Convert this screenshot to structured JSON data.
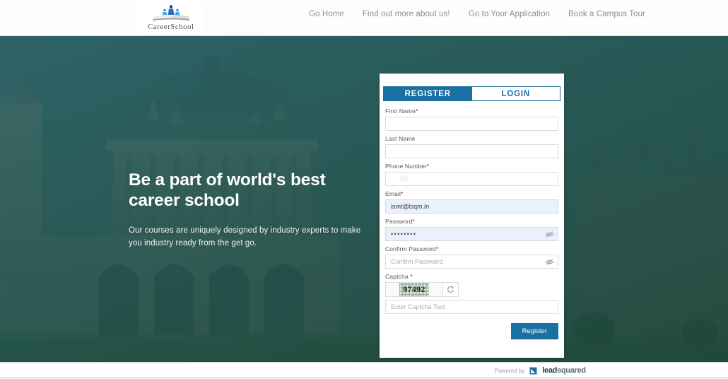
{
  "header": {
    "logo": {
      "icon": "careerschool-logo-icon",
      "text": "CareerSchool"
    },
    "nav": [
      {
        "label": "Go Home"
      },
      {
        "label": "Find out more about us!"
      },
      {
        "label": "Go to Your Application"
      },
      {
        "label": "Book a Campus Tour"
      }
    ]
  },
  "hero": {
    "title": "Be a part of world's best career school",
    "subtitle": "Our courses are uniquely designed by industry experts  to make you industry ready from the get go."
  },
  "card": {
    "tabs": [
      {
        "label": "REGISTER",
        "active": true
      },
      {
        "label": "LOGIN",
        "active": false
      }
    ],
    "fields": {
      "first_name": {
        "label": "First Name",
        "required": "*",
        "value": "",
        "placeholder": ""
      },
      "last_name": {
        "label": "Last Name",
        "required": "",
        "value": "",
        "placeholder": ""
      },
      "phone": {
        "label": "Phone Number",
        "required": "*",
        "value": "",
        "placeholder": ""
      },
      "email": {
        "label": "Email",
        "required": "*",
        "value": "ismt@lsqm.in",
        "placeholder": ""
      },
      "password": {
        "label": "Password",
        "required": "*",
        "value": "••••••••",
        "placeholder": ""
      },
      "confirm_password": {
        "label": "Confirm Password",
        "required": "*",
        "value": "",
        "placeholder": "Confirm Password"
      },
      "captcha": {
        "label": "Captcha",
        "required": "*",
        "code": "97492",
        "placeholder": "Enter Captcha Text"
      }
    },
    "submit_label": "Register"
  },
  "footer": {
    "powered_by": "Powered by",
    "brand_bold": "lead",
    "brand_light": "squared"
  },
  "colors": {
    "accent": "#1a6fa3",
    "required": "#d0021b",
    "filled_field": "#eaf1fb",
    "hero_tint": "#2d5a5c"
  }
}
